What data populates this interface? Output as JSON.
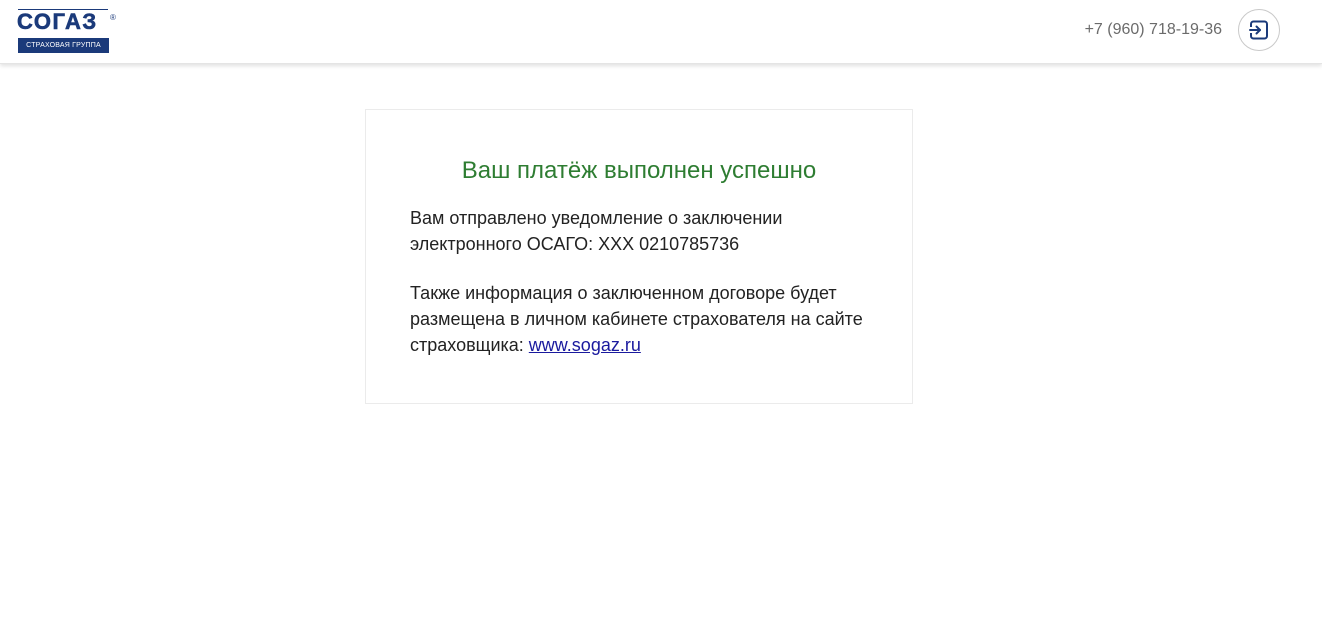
{
  "header": {
    "logo": {
      "wordmark": "СОГАЗ",
      "registered_mark": "®",
      "tagline": "СТРАХОВАЯ ГРУППА",
      "color": "#1b3a7a"
    },
    "phone": "+7 (960) 718-19-36",
    "logout_icon": "logout-icon"
  },
  "card": {
    "title": "Ваш платёж выполнен успешно",
    "title_color": "#2e7d32",
    "notice": "Вам отправлено уведомление о заключении электронного ОСАГО: ХХХ 0210785736",
    "info_prefix": "Также информация о заключенном договоре будет размещена в личном кабинете страхователя на сайте страховщика: ",
    "link_text": "www.sogaz.ru"
  }
}
